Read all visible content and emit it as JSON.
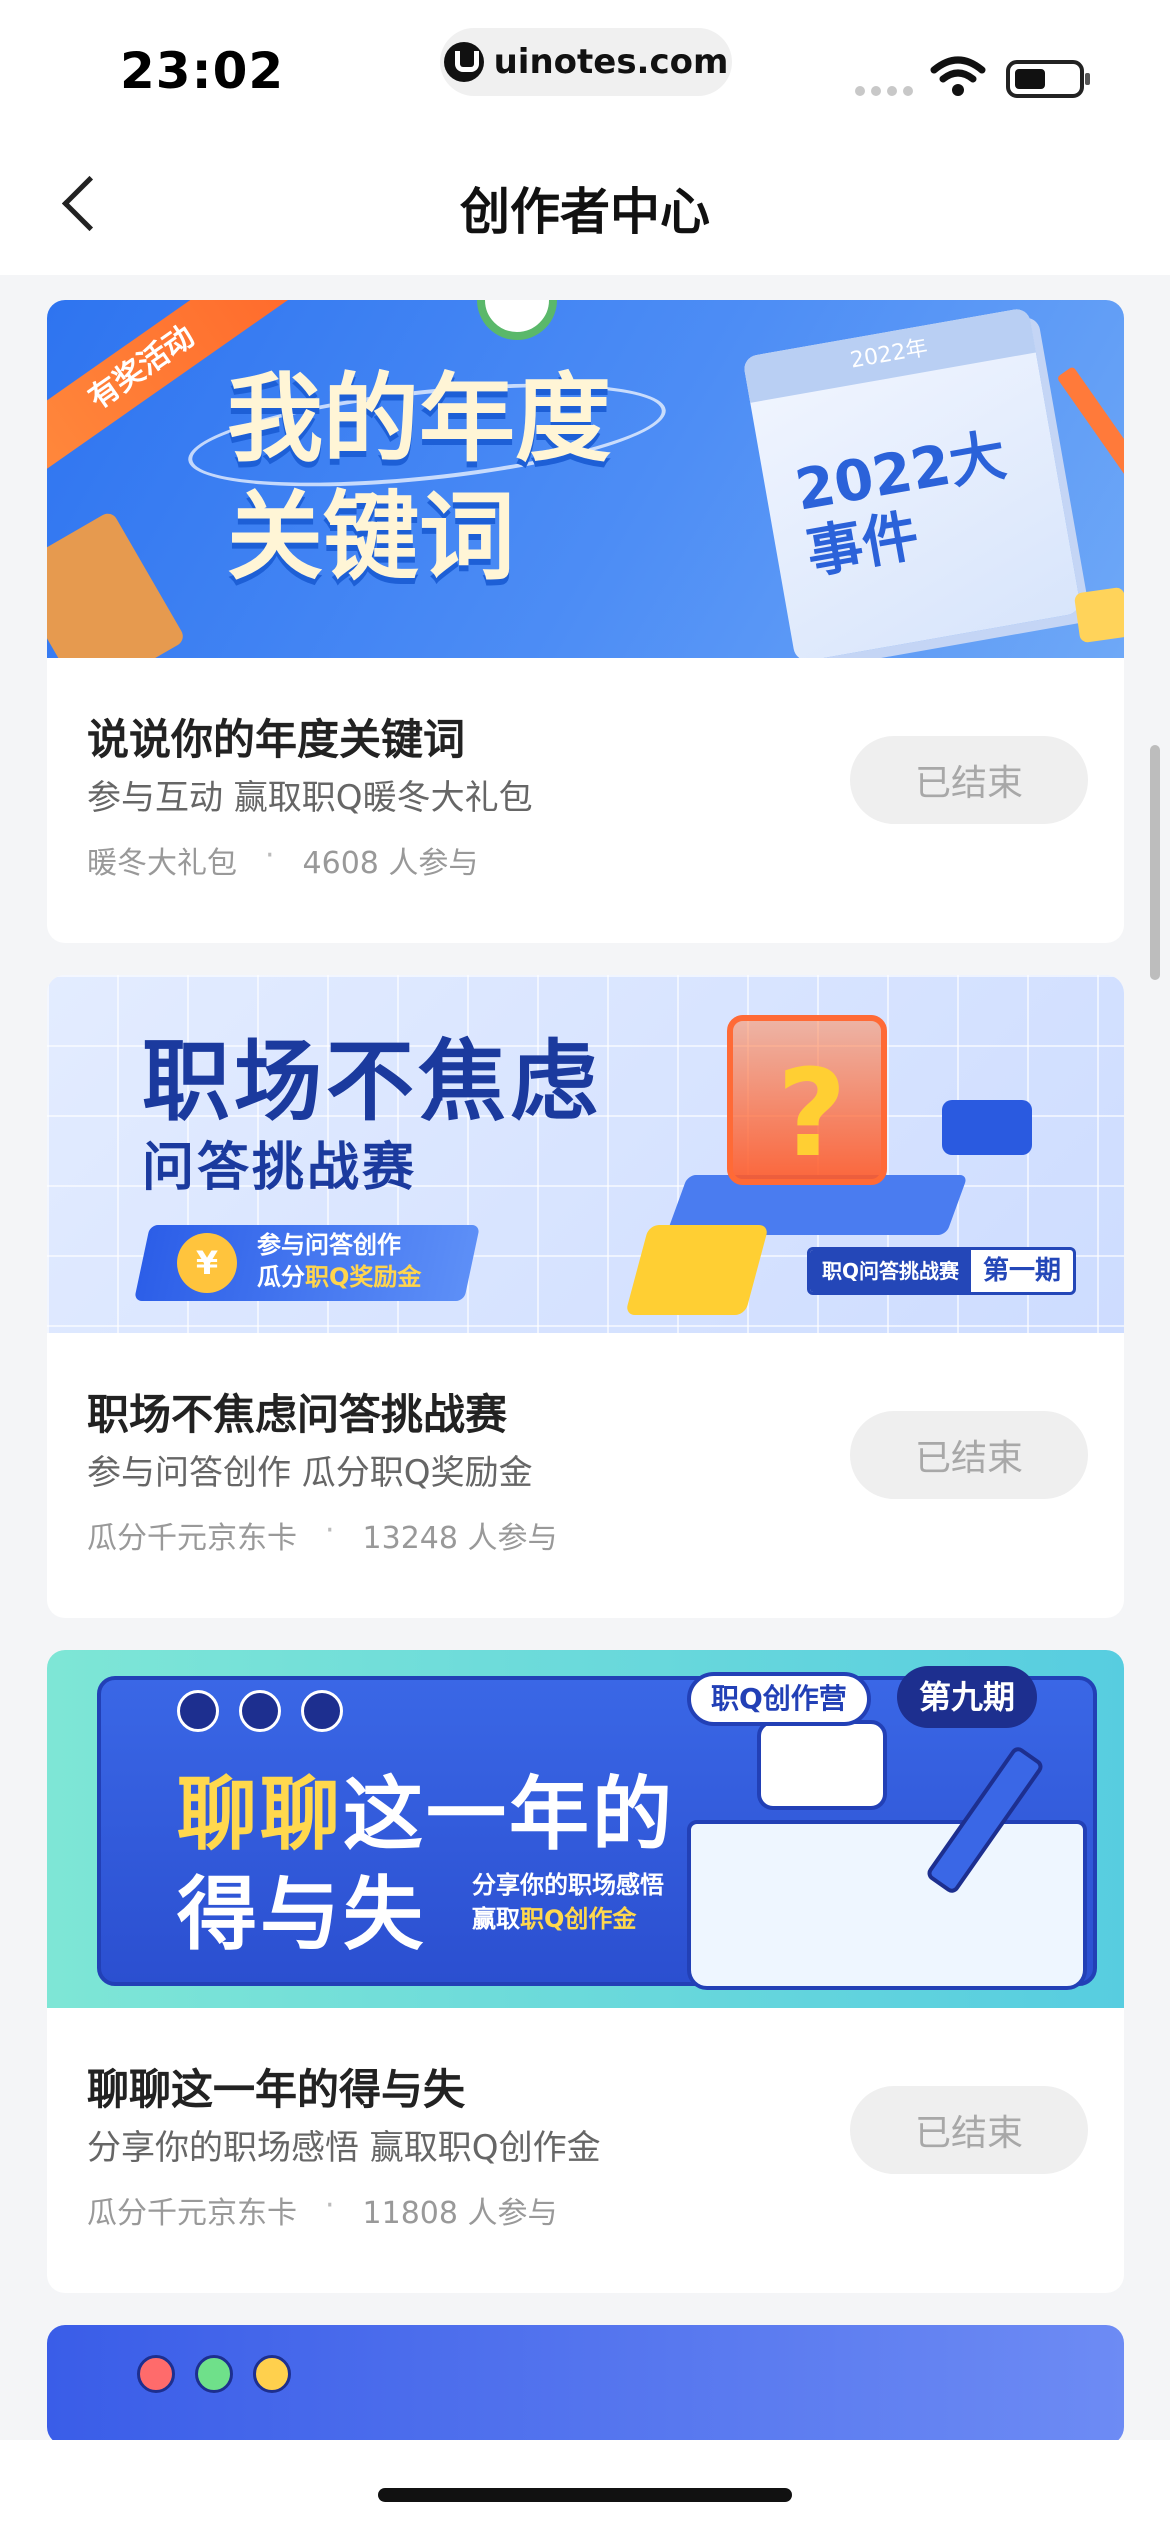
{
  "status_bar": {
    "time": "23:02",
    "url": "uinotes.com"
  },
  "nav": {
    "title": "创作者中心",
    "back_icon": "chevron-left-icon"
  },
  "cards": [
    {
      "banner": {
        "ribbon": "有奖活动",
        "headline_line1": "我的年度",
        "headline_line2": "关键词",
        "calendar_year": "2022年",
        "calendar_text": "2022大事件"
      },
      "title": "说说你的年度关键词",
      "subtitle": "参与互动 赢取职Q暖冬大礼包",
      "reward": "暖冬大礼包",
      "participants": "4608 人参与",
      "status": "已结束"
    },
    {
      "banner": {
        "headline_line1": "职场不焦虑",
        "headline_line2": "问答挑战赛",
        "chip_line1": "参与问答创作",
        "chip_line2_prefix": "瓜分",
        "chip_line2_highlight": "职Q奖励金",
        "tag_label": "职Q问答挑战赛",
        "tag_issue": "第一期"
      },
      "title": "职场不焦虑问答挑战赛",
      "subtitle": "参与问答创作  瓜分职Q奖励金",
      "reward": "瓜分千元京东卡",
      "participants": "13248 人参与",
      "status": "已结束"
    },
    {
      "banner": {
        "pill_label": "职Q创作营",
        "pill_issue": "第九期",
        "headline_line1_highlight": "聊聊",
        "headline_line1_rest": "这一年的",
        "headline_line2": "得与失",
        "side_line1": "分享你的职场感悟",
        "side_line2_prefix": "赢取",
        "side_line2_highlight": "职Q创作金"
      },
      "title": "聊聊这一年的得与失",
      "subtitle": "分享你的职场感悟 赢取职Q创作金",
      "reward": "瓜分千元京东卡",
      "participants": "11808 人参与",
      "status": "已结束"
    }
  ],
  "colors": {
    "page_bg": "#f4f5f7",
    "end_button_bg": "#efefef",
    "end_button_text": "#a8a8a8"
  }
}
